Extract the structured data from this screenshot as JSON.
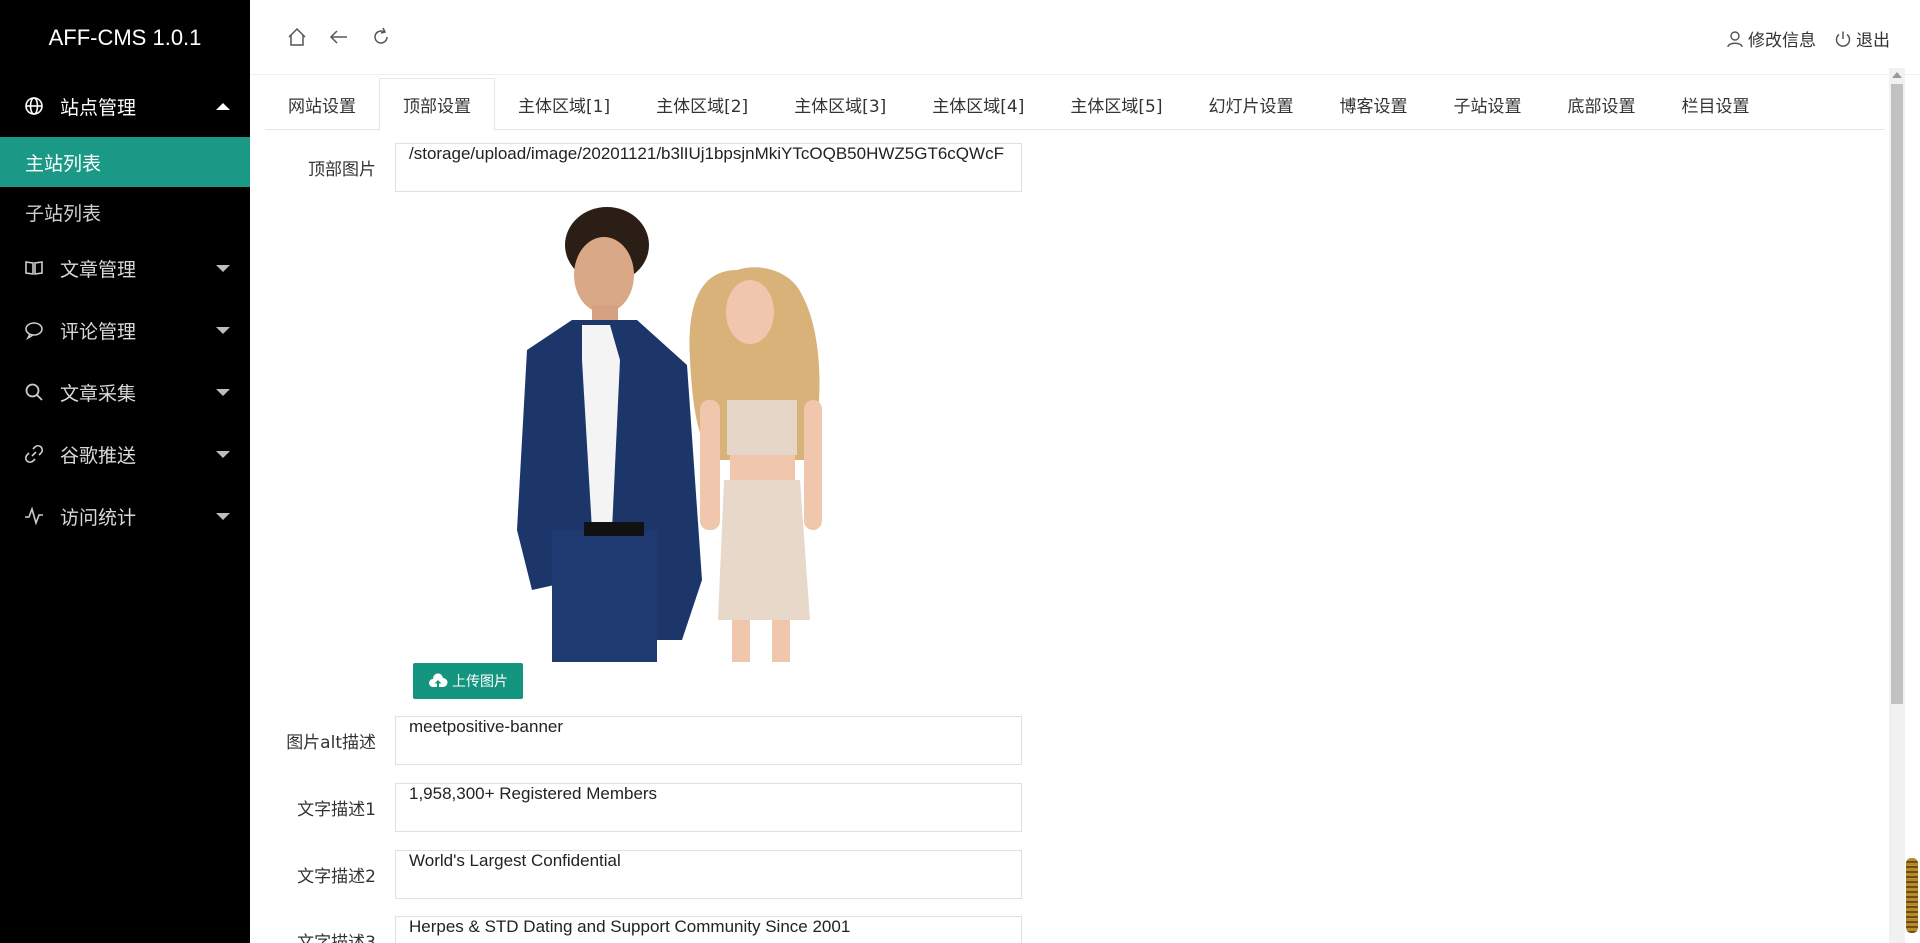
{
  "app": {
    "title": "AFF-CMS 1.0.1"
  },
  "sidebar": {
    "groups": [
      {
        "label": "站点管理",
        "icon": "globe-icon",
        "open": true,
        "children": [
          {
            "label": "主站列表",
            "active": true
          },
          {
            "label": "子站列表",
            "active": false
          }
        ]
      },
      {
        "label": "文章管理",
        "icon": "book-icon",
        "open": false
      },
      {
        "label": "评论管理",
        "icon": "comment-icon",
        "open": false
      },
      {
        "label": "文章采集",
        "icon": "search-icon",
        "open": false
      },
      {
        "label": "谷歌推送",
        "icon": "link-icon",
        "open": false
      },
      {
        "label": "访问统计",
        "icon": "pulse-icon",
        "open": false
      }
    ]
  },
  "header": {
    "nav_icons": [
      "home-icon",
      "back-arrow-icon",
      "refresh-icon"
    ],
    "edit_info": "修改信息",
    "logout": "退出"
  },
  "tabs": [
    {
      "label": "网站设置",
      "active": false
    },
    {
      "label": "顶部设置",
      "active": true
    },
    {
      "label": "主体区域[1]",
      "active": false
    },
    {
      "label": "主体区域[2]",
      "active": false
    },
    {
      "label": "主体区域[3]",
      "active": false
    },
    {
      "label": "主体区域[4]",
      "active": false
    },
    {
      "label": "主体区域[5]",
      "active": false
    },
    {
      "label": "幻灯片设置",
      "active": false
    },
    {
      "label": "博客设置",
      "active": false
    },
    {
      "label": "子站设置",
      "active": false
    },
    {
      "label": "底部设置",
      "active": false
    },
    {
      "label": "栏目设置",
      "active": false
    }
  ],
  "form": {
    "top_image_label": "顶部图片",
    "top_image_value": "/storage/upload/image/20201121/b3lIUj1bpsjnMkiYTcOQB50HWZ5GT6cQWcF",
    "upload_button": "上传图片",
    "alt_label": "图片alt描述",
    "alt_value": "meetpositive-banner",
    "text1_label": "文字描述1",
    "text1_value": "1,958,300+ Registered Members",
    "text2_label": "文字描述2",
    "text2_value": "World's Largest Confidential",
    "text3_label": "文字描述3",
    "text3_value": "Herpes & STD Dating and Support Community Since 2001"
  },
  "colors": {
    "accent": "#1a9a86",
    "sidebar_bg": "#000000",
    "upload_btn": "#14957f"
  }
}
